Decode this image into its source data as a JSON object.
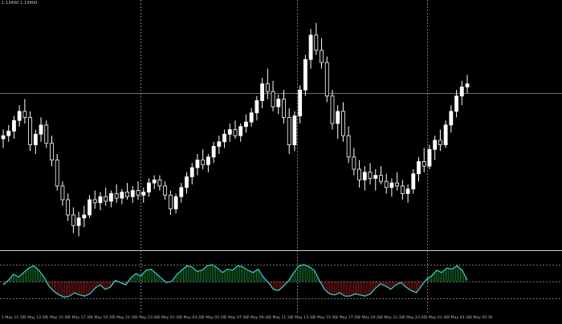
{
  "info_label": "1.13400 1.13400",
  "colors": {
    "background": "#000000",
    "candle": "#ffffff",
    "grid": "#9a9a9a",
    "separator": "#cfcfcf",
    "oscillator_line": "#36d6d6",
    "histogram_positive": "#22a83c",
    "histogram_negative": "#c22222",
    "axis_text": "#bdbdbd"
  },
  "chart_data": [
    {
      "type": "candlestick",
      "title": "",
      "grid": "dashed vertical, solid horizontal crosshair",
      "series": [
        {
          "name": "",
          "ohlc": [
            [
              1.134,
              1.1346,
              1.1334,
              1.1342
            ],
            [
              1.1342,
              1.1349,
              1.1338,
              1.1345
            ],
            [
              1.1345,
              1.1355,
              1.134,
              1.1352
            ],
            [
              1.1352,
              1.1362,
              1.1348,
              1.1358
            ],
            [
              1.1358,
              1.1366,
              1.135,
              1.1354
            ],
            [
              1.1354,
              1.1358,
              1.1332,
              1.1336
            ],
            [
              1.1336,
              1.1346,
              1.133,
              1.1343
            ],
            [
              1.1343,
              1.1354,
              1.1338,
              1.1349
            ],
            [
              1.1349,
              1.1352,
              1.1334,
              1.1337
            ],
            [
              1.1337,
              1.1342,
              1.1322,
              1.1326
            ],
            [
              1.1326,
              1.133,
              1.1306,
              1.1309
            ],
            [
              1.1309,
              1.1312,
              1.1296,
              1.13
            ],
            [
              1.13,
              1.1304,
              1.1286,
              1.129
            ],
            [
              1.129,
              1.1295,
              1.1278,
              1.1283
            ],
            [
              1.1283,
              1.1292,
              1.1276,
              1.1288
            ],
            [
              1.1288,
              1.1296,
              1.1282,
              1.129
            ],
            [
              1.129,
              1.1303,
              1.1288,
              1.13
            ],
            [
              1.13,
              1.1306,
              1.1294,
              1.1298
            ],
            [
              1.1298,
              1.1305,
              1.1293,
              1.1302
            ],
            [
              1.1302,
              1.1308,
              1.1296,
              1.1299
            ],
            [
              1.1299,
              1.1306,
              1.1295,
              1.1304
            ],
            [
              1.1304,
              1.131,
              1.1298,
              1.1301
            ],
            [
              1.1301,
              1.1307,
              1.1297,
              1.1305
            ],
            [
              1.1305,
              1.1311,
              1.13,
              1.1302
            ],
            [
              1.1302,
              1.1309,
              1.1298,
              1.1306
            ],
            [
              1.1306,
              1.1312,
              1.13,
              1.1303
            ],
            [
              1.1303,
              1.1308,
              1.1298,
              1.1305
            ],
            [
              1.1305,
              1.1314,
              1.1302,
              1.1311
            ],
            [
              1.1311,
              1.1316,
              1.1307,
              1.1313
            ],
            [
              1.1313,
              1.1316,
              1.1306,
              1.1309
            ],
            [
              1.1309,
              1.1312,
              1.13,
              1.1303
            ],
            [
              1.1303,
              1.1306,
              1.129,
              1.1294
            ],
            [
              1.1294,
              1.1304,
              1.1291,
              1.1302
            ],
            [
              1.1302,
              1.1311,
              1.1298,
              1.1308
            ],
            [
              1.1308,
              1.1318,
              1.1304,
              1.1315
            ],
            [
              1.1315,
              1.1324,
              1.131,
              1.1321
            ],
            [
              1.1321,
              1.133,
              1.1316,
              1.1326
            ],
            [
              1.1326,
              1.1333,
              1.132,
              1.1323
            ],
            [
              1.1323,
              1.133,
              1.1318,
              1.1328
            ],
            [
              1.1328,
              1.1338,
              1.1324,
              1.1335
            ],
            [
              1.1335,
              1.1342,
              1.133,
              1.1338
            ],
            [
              1.1338,
              1.1346,
              1.1334,
              1.1343
            ],
            [
              1.1343,
              1.135,
              1.1338,
              1.1346
            ],
            [
              1.1346,
              1.1352,
              1.134,
              1.1342
            ],
            [
              1.1342,
              1.135,
              1.1338,
              1.1348
            ],
            [
              1.1348,
              1.1356,
              1.1344,
              1.1351
            ],
            [
              1.1351,
              1.136,
              1.1348,
              1.1357
            ],
            [
              1.1357,
              1.1368,
              1.1352,
              1.1365
            ],
            [
              1.1365,
              1.138,
              1.136,
              1.1376
            ],
            [
              1.1376,
              1.1386,
              1.1366,
              1.1371
            ],
            [
              1.1371,
              1.1378,
              1.1358,
              1.1361
            ],
            [
              1.1361,
              1.1369,
              1.1356,
              1.1366
            ],
            [
              1.1366,
              1.1372,
              1.135,
              1.1354
            ],
            [
              1.1354,
              1.136,
              1.133,
              1.1336
            ],
            [
              1.1336,
              1.1358,
              1.1332,
              1.1355
            ],
            [
              1.1355,
              1.1375,
              1.135,
              1.1372
            ],
            [
              1.1372,
              1.1395,
              1.1368,
              1.1392
            ],
            [
              1.1392,
              1.1412,
              1.1386,
              1.1408
            ],
            [
              1.1408,
              1.1416,
              1.1395,
              1.1398
            ],
            [
              1.1398,
              1.1406,
              1.1386,
              1.139
            ],
            [
              1.139,
              1.1394,
              1.1364,
              1.1368
            ],
            [
              1.1368,
              1.1372,
              1.1346,
              1.135
            ],
            [
              1.135,
              1.1362,
              1.134,
              1.1358
            ],
            [
              1.1358,
              1.1364,
              1.1338,
              1.1342
            ],
            [
              1.1342,
              1.1348,
              1.1324,
              1.1328
            ],
            [
              1.1328,
              1.1334,
              1.1316,
              1.132
            ],
            [
              1.132,
              1.1326,
              1.1308,
              1.1313
            ],
            [
              1.1313,
              1.1322,
              1.1306,
              1.1318
            ],
            [
              1.1318,
              1.1324,
              1.131,
              1.1314
            ],
            [
              1.1314,
              1.132,
              1.1306,
              1.1316
            ],
            [
              1.1316,
              1.1322,
              1.131,
              1.1312
            ],
            [
              1.1312,
              1.1317,
              1.1304,
              1.1308
            ],
            [
              1.1308,
              1.1314,
              1.1302,
              1.1311
            ],
            [
              1.1311,
              1.1318,
              1.1306,
              1.1309
            ],
            [
              1.1309,
              1.1313,
              1.13,
              1.1304
            ],
            [
              1.1304,
              1.131,
              1.1298,
              1.1307
            ],
            [
              1.1307,
              1.132,
              1.1304,
              1.1317
            ],
            [
              1.1317,
              1.1328,
              1.1312,
              1.1325
            ],
            [
              1.1325,
              1.1334,
              1.1318,
              1.1322
            ],
            [
              1.1322,
              1.1336,
              1.132,
              1.1333
            ],
            [
              1.1333,
              1.1342,
              1.1326,
              1.1339
            ],
            [
              1.1339,
              1.1346,
              1.1332,
              1.1336
            ],
            [
              1.1336,
              1.1352,
              1.1334,
              1.1349
            ],
            [
              1.1349,
              1.1362,
              1.1344,
              1.1358
            ],
            [
              1.1358,
              1.1372,
              1.1354,
              1.1368
            ],
            [
              1.1368,
              1.1378,
              1.1362,
              1.1374
            ],
            [
              1.1374,
              1.1382,
              1.137,
              1.1376
            ]
          ]
        }
      ],
      "ylim": [
        1.127,
        1.143
      ],
      "crosshair_price": 1.137,
      "vertical_grid_after_bars": [
        25,
        54,
        78
      ]
    },
    {
      "type": "histogram+line",
      "title": "",
      "ylim": [
        0,
        100
      ],
      "levels": [
        80,
        50,
        20
      ],
      "series": [
        {
          "name": "",
          "values": [
            44,
            52,
            63,
            58,
            66,
            74,
            78,
            70,
            58,
            41,
            32,
            26,
            22,
            24,
            30,
            26,
            24,
            28,
            38,
            44,
            36,
            40,
            52,
            48,
            44,
            56,
            64,
            60,
            70,
            72,
            64,
            56,
            48,
            50,
            62,
            70,
            78,
            76,
            68,
            70,
            78,
            80,
            74,
            66,
            72,
            70,
            78,
            76,
            70,
            66,
            72,
            58,
            48,
            36,
            34,
            42,
            52,
            66,
            78,
            80,
            76,
            70,
            52,
            36,
            28,
            26,
            30,
            24,
            24,
            28,
            26,
            24,
            28,
            38,
            46,
            42,
            36,
            44,
            48,
            40,
            34,
            30,
            42,
            54,
            60,
            70,
            66,
            74,
            72,
            78,
            70,
            52
          ]
        }
      ],
      "x_tick_labels": [
        "1 May 11:30",
        "1 May 13:30",
        "1 May 15:30",
        "1 May 17:30",
        "1 May 19:30",
        "1 May 21:30",
        "1 May 23:30",
        "2 May 01:30",
        "2 May 03:30",
        "2 May 05:30",
        "2 May 07:30",
        "2 May 09:30",
        "2 May 11:30",
        "2 May 13:30",
        "2 May 15:30",
        "2 May 17:30",
        "2 May 19:30",
        "2 May 21:30",
        "2 May 23:30",
        "3 May 01:30",
        "3 May 03:30",
        "3 May 05:30"
      ]
    }
  ]
}
